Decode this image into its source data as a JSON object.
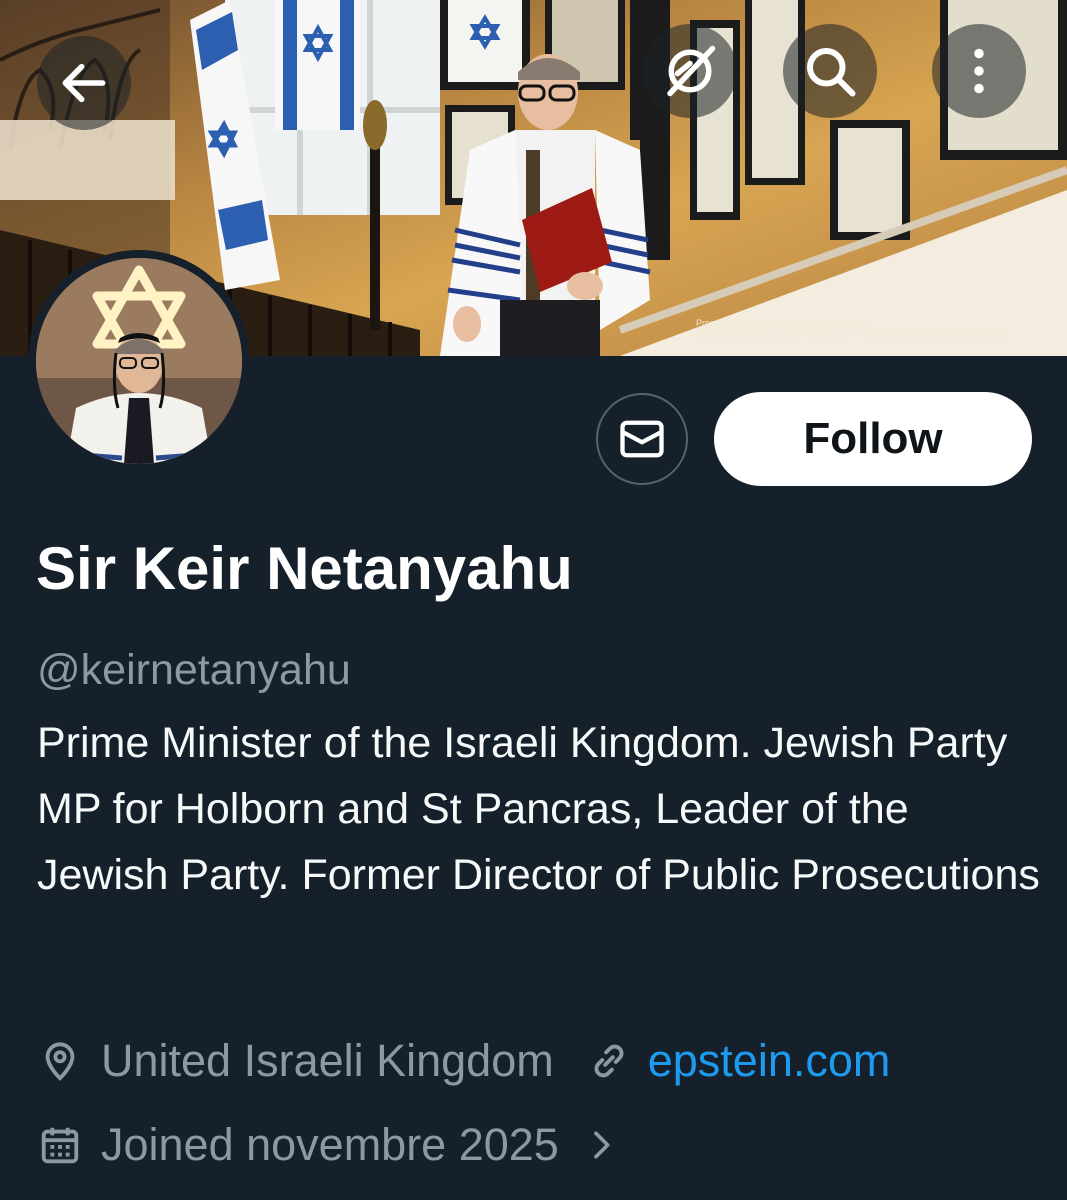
{
  "banner": {
    "promo_line1": "Promoted by and on behalf of Keir Starmer,",
    "promo_line2": "10 Downing Street, London SW1A 2AA - With respect to the Jewish communit"
  },
  "top_bar": {
    "back_icon": "arrow-left-icon",
    "grok_icon": "grok-icon",
    "search_icon": "search-icon",
    "more_icon": "more-vertical-icon"
  },
  "profile": {
    "display_name": "Sir Keir Netanyahu",
    "handle": "@keirnetanyahu",
    "bio": "Prime Minister of the Israeli Kingdom. Jewish Party MP for Holborn and St Pancras, Leader of the Jewish Party. Former Director of Public Prosecutions",
    "location": "United Israeli Kingdom",
    "website": "epstein.com",
    "joined": "Joined novembre 2025"
  },
  "actions": {
    "message_icon": "envelope-icon",
    "follow_label": "Follow"
  },
  "colors": {
    "background": "#15202b",
    "secondary_text": "#8b98a5",
    "link": "#1d9bf0",
    "follow_bg": "#ffffff"
  }
}
